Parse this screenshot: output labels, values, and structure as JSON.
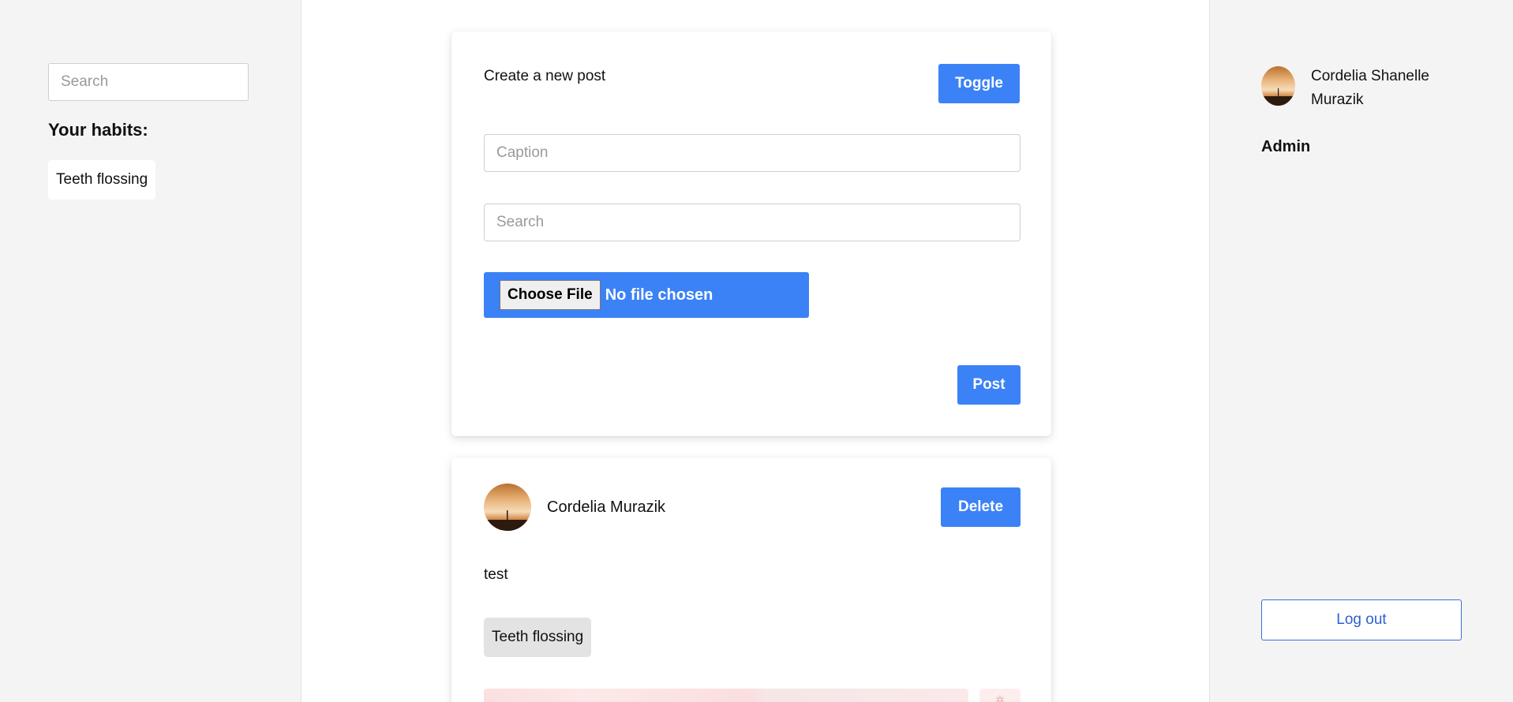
{
  "left_sidebar": {
    "search_placeholder": "Search",
    "habits_heading": "Your habits:",
    "habits": [
      "Teeth flossing"
    ]
  },
  "create_post": {
    "title": "Create a new post",
    "toggle_label": "Toggle",
    "caption_placeholder": "Caption",
    "search_placeholder": "Search",
    "choose_file_label": "Choose File",
    "file_status": "No file chosen",
    "post_label": "Post"
  },
  "post": {
    "author": "Cordelia Murazik",
    "delete_label": "Delete",
    "caption": "test",
    "tag": "Teeth flossing",
    "avatar_icon": "sunset-photo-avatar"
  },
  "right_sidebar": {
    "user_name": "Cordelia Shanelle Murazik",
    "role": "Admin",
    "logout_label": "Log out",
    "avatar_icon": "sunset-photo-avatar"
  },
  "colors": {
    "accent": "#3b82f6",
    "sidebar_bg": "#f4f4f4",
    "logout_border": "#3b6fd4"
  }
}
